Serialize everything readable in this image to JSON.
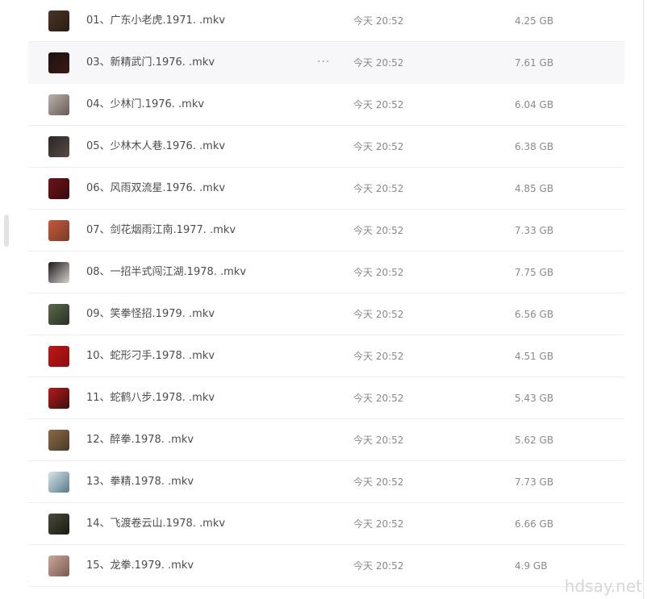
{
  "files": [
    {
      "name": "01、广东小老虎.1971. .mkv",
      "time": "今天 20:52",
      "size": "4.25 GB",
      "thumb": [
        "#4a3528",
        "#2a1c14"
      ]
    },
    {
      "name": "03、新精武门.1976. .mkv",
      "time": "今天 20:52",
      "size": "7.61 GB",
      "thumb": [
        "#1a1212",
        "#3a1a14"
      ],
      "selected": true,
      "more": "···"
    },
    {
      "name": "04、少林门.1976. .mkv",
      "time": "今天 20:52",
      "size": "6.04 GB",
      "thumb": [
        "#b9b2ab",
        "#6a5a54"
      ]
    },
    {
      "name": "05、少林木人巷.1976. .mkv",
      "time": "今天 20:52",
      "size": "6.38 GB",
      "thumb": [
        "#2a2626",
        "#5a4a44"
      ]
    },
    {
      "name": "06、风雨双流星.1976. .mkv",
      "time": "今天 20:52",
      "size": "4.85 GB",
      "thumb": [
        "#6a1418",
        "#3a0a0c"
      ]
    },
    {
      "name": "07、剑花烟雨江南.1977. .mkv",
      "time": "今天 20:52",
      "size": "7.33 GB",
      "thumb": [
        "#c45a38",
        "#7a3a2a"
      ]
    },
    {
      "name": "08、一招半式闯江湖.1978. .mkv",
      "time": "今天 20:52",
      "size": "7.75 GB",
      "thumb": [
        "#1a1a1a",
        "#d8d0cc"
      ]
    },
    {
      "name": "09、笑拳怪招.1979. .mkv",
      "time": "今天 20:52",
      "size": "6.56 GB",
      "thumb": [
        "#5a6a4a",
        "#2a3024"
      ]
    },
    {
      "name": "10、蛇形刁手.1978. .mkv",
      "time": "今天 20:52",
      "size": "4.51 GB",
      "thumb": [
        "#c01818",
        "#8a0c0c"
      ]
    },
    {
      "name": "11、蛇鹤八步.1978. .mkv",
      "time": "今天 20:52",
      "size": "5.43 GB",
      "thumb": [
        "#b81a1a",
        "#3a1010"
      ]
    },
    {
      "name": "12、醉拳.1978. .mkv",
      "time": "今天 20:52",
      "size": "5.62 GB",
      "thumb": [
        "#8a6a44",
        "#4a3a28"
      ]
    },
    {
      "name": "13、拳精.1978. .mkv",
      "time": "今天 20:52",
      "size": "7.73 GB",
      "thumb": [
        "#d8e4ea",
        "#5a7a88"
      ]
    },
    {
      "name": "14、飞渡卷云山.1978. .mkv",
      "time": "今天 20:52",
      "size": "6.66 GB",
      "thumb": [
        "#4a4a3a",
        "#1a1a14"
      ]
    },
    {
      "name": "15、龙拳.1979. .mkv",
      "time": "今天 20:52",
      "size": "4.9 GB",
      "thumb": [
        "#caa89a",
        "#7a5a50"
      ]
    }
  ],
  "watermark": "hdsay.net"
}
